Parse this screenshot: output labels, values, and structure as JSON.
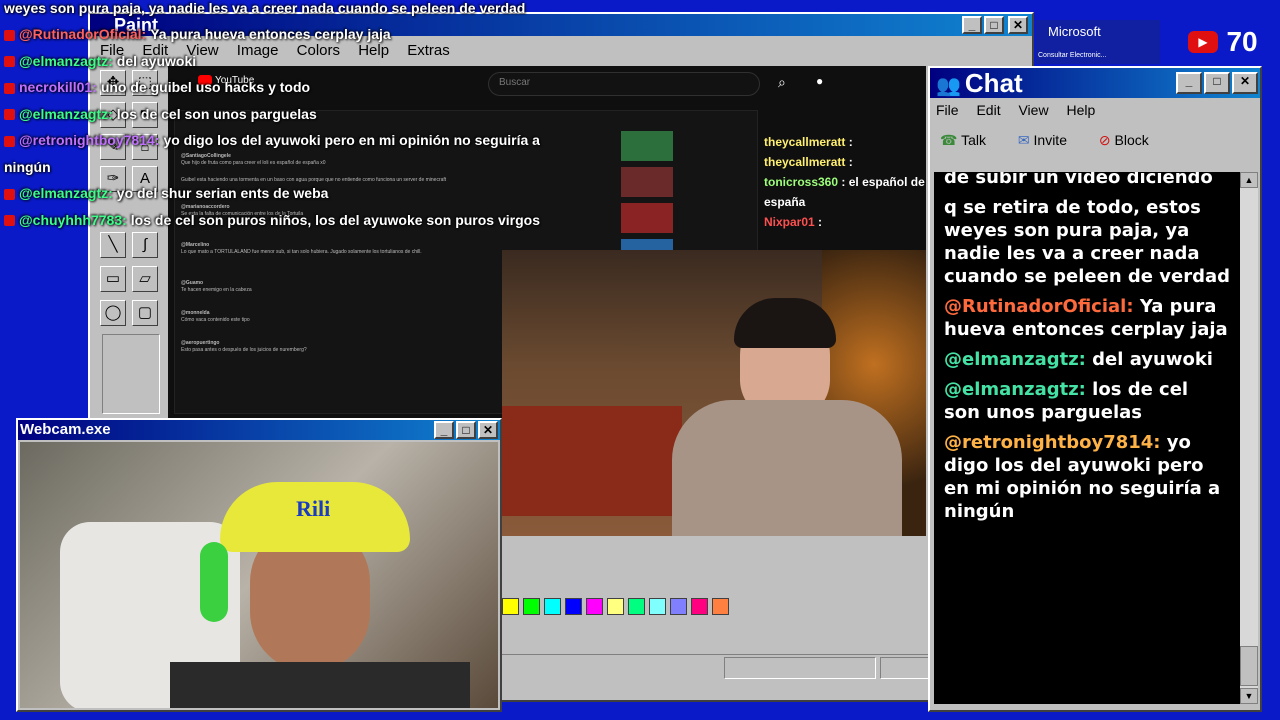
{
  "overlay_chat": {
    "top_line": "weyes son pura paja, ya nadie les va a creer nada cuando se peleen de verdad",
    "lines": [
      {
        "user": "@RutinadorOficial",
        "sep": ":",
        "text": "Ya pura hueva entonces cerplay jaja",
        "color": "#ff6060"
      },
      {
        "user": "@elmanzagtz",
        "sep": ":",
        "text": "del ayuwoki",
        "color": "#3cff8a"
      },
      {
        "user": "necrokill01",
        "sep": ":",
        "text": "uno de guibel uso hacks y todo",
        "color": "#c070ff"
      },
      {
        "user": "@elmanzagtz",
        "sep": ":",
        "text": "los de cel son unos parguelas",
        "color": "#3cff8a"
      },
      {
        "user": "@retronightboy7814",
        "sep": ":",
        "text": "yo digo los del ayuwoki pero en mi opinión no seguiría a",
        "color": "#c070ff"
      },
      {
        "user": "",
        "sep": "",
        "text": "ningún",
        "color": "#ffffff"
      },
      {
        "user": "@elmanzagtz",
        "sep": ":",
        "text": "yo del shur serian ents de weba",
        "color": "#3cff8a"
      },
      {
        "user": "@chuyhhh7783",
        "sep": ":",
        "text": "los de cel son puros niños, los del ayuwoke son puros virgos",
        "color": "#3cff8a"
      }
    ]
  },
  "paint": {
    "title": "Paint",
    "menu": [
      "File",
      "Edit",
      "View",
      "Image",
      "Colors",
      "Help",
      "Extras"
    ],
    "tools": [
      "✥",
      "⬚",
      "◇",
      "↖",
      "✎",
      "⌂",
      "✑",
      "A",
      "╲",
      "∫",
      "▭",
      "▱",
      "◯",
      "▢"
    ],
    "palette": [
      "#ffff00",
      "#00ff00",
      "#00ffff",
      "#0000ff",
      "#ff00ff",
      "#ffff80",
      "#00ff80",
      "#80ffff",
      "#8080ff",
      "#ff0080",
      "#ff8040"
    ]
  },
  "youtube": {
    "search_placeholder": "Buscar",
    "logo": "YouTube",
    "comments": [
      {
        "user": "@SantiagoCollingele",
        "text": "Que hijo de fruta como para creer el loli es español de españa x0"
      },
      {
        "user": "",
        "text": "Guibel esta haciendo una tormenta en un baso con agua porque que no entiende como funciona un server de minecraft"
      },
      {
        "user": "@marianoaccordero",
        "text": "Se esta la falta de comunicación entre los de la Tortuila"
      },
      {
        "user": "@Marcelino",
        "text": "Lo que mato a TORTULALAND fue menor sub, si tan solo hubiera. Jugado solamente los tortulianos de chill."
      },
      {
        "user": "@Guamo",
        "text": "Te hacen enemigo en la cabeza"
      },
      {
        "user": "@monnelda",
        "text": "Cómo vaca contenido este tipo"
      },
      {
        "user": "@aeropuertingo",
        "text": "Esto pasa antes o después de los juicios de nuremberg?"
      }
    ]
  },
  "stream_overlay_right": {
    "lines": [
      {
        "user": "theycallmeratt",
        "text": ":"
      },
      {
        "user": "theycallmeratt",
        "text": ":"
      },
      {
        "user": "tonicross360",
        "text": ": el español de españa"
      },
      {
        "user": "Nixpar01",
        "text": ":"
      }
    ]
  },
  "webcam": {
    "title": "Webcam.exe",
    "hat_text": "Rili"
  },
  "viewer_count": "70",
  "msn_bar": {
    "brand": "Microsoft",
    "sub": "Consultar Electronic..."
  },
  "chat_window": {
    "title": "Chat",
    "menu": [
      "File",
      "Edit",
      "View",
      "Help"
    ],
    "toolbar": [
      "Talk",
      "Invite",
      "Block"
    ],
    "partial_top": "de subir un video diciendo",
    "messages": [
      {
        "user": "",
        "text": "q se retira de todo, estos weyes son pura paja, ya nadie les va a creer nada cuando se peleen de verdad"
      },
      {
        "user": "@RutinadorOficial:",
        "text": "Ya pura hueva entonces cerplay jaja"
      },
      {
        "user": "@elmanzagtz:",
        "text": "del ayuwoki"
      },
      {
        "user": "@elmanzagtz:",
        "text": "los de cel son unos parguelas"
      },
      {
        "user": "@retronightboy7814:",
        "text": "yo digo los del ayuwoki pero en mi opinión no seguiría a ningún"
      }
    ],
    "colors": {
      "rutinador": "#ff6a3d",
      "elmanza": "#44e2a4",
      "retro": "#ffb347"
    }
  }
}
